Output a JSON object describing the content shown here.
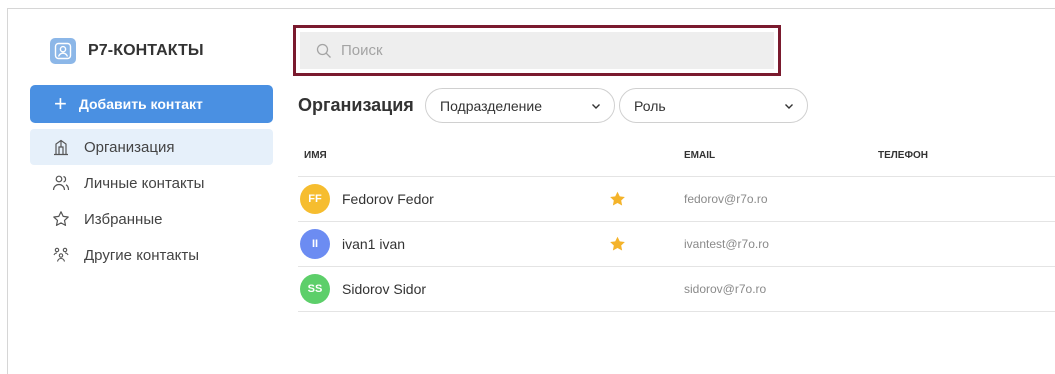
{
  "app": {
    "title": "Р7-КОНТАКТЫ"
  },
  "sidebar": {
    "add_button_label": "Добавить контакт",
    "items": [
      {
        "label": "Организация",
        "icon": "building-icon",
        "active": true
      },
      {
        "label": "Личные контакты",
        "icon": "people-icon",
        "active": false
      },
      {
        "label": "Избранные",
        "icon": "star-outline-icon",
        "active": false
      },
      {
        "label": "Другие контакты",
        "icon": "group-icon",
        "active": false
      }
    ]
  },
  "search": {
    "placeholder": "Поиск",
    "value": ""
  },
  "filters": {
    "title": "Организация",
    "department": "Подразделение",
    "role": "Роль"
  },
  "table": {
    "headers": {
      "name": "ИМЯ",
      "email": "EMAIL",
      "phone": "ТЕЛЕФОН"
    },
    "rows": [
      {
        "initials": "FF",
        "name": "Fedorov Fedor",
        "email": "fedorov@r7o.ro",
        "phone": "",
        "favorite": true,
        "avatar_color": "#f6bd2f"
      },
      {
        "initials": "II",
        "name": "ivan1 ivan",
        "email": "ivantest@r7o.ro",
        "phone": "",
        "favorite": true,
        "avatar_color": "#6c8cf2"
      },
      {
        "initials": "SS",
        "name": "Sidorov Sidor",
        "email": "sidorov@r7o.ro",
        "phone": "",
        "favorite": false,
        "avatar_color": "#5dcf6a"
      }
    ]
  },
  "colors": {
    "accent": "#4a90e2",
    "active_bg": "#e6f0fa",
    "favorite_star": "#f4b32a",
    "search_highlight": "#7a1a2e"
  }
}
